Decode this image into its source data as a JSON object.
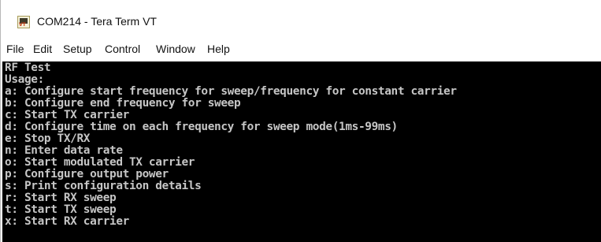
{
  "window": {
    "title": "COM214 - Tera Term VT",
    "app_icon": "tera-term-icon"
  },
  "menu": {
    "file": "File",
    "edit": "Edit",
    "setup": "Setup",
    "control": "Control",
    "window": "Window",
    "help": "Help"
  },
  "terminal": {
    "background": "#000000",
    "foreground": "#c6c6c6",
    "lines": [
      "RF Test",
      "Usage:",
      "a: Configure start frequency for sweep/frequency for constant carrier",
      "b: Configure end frequency for sweep",
      "c: Start TX carrier",
      "d: Configure time on each frequency for sweep mode(1ms-99ms)",
      "e: Stop TX/RX",
      "n: Enter data rate",
      "o: Start modulated TX carrier",
      "p: Configure output power",
      "s: Print configuration details",
      "r: Start RX sweep",
      "t: Start TX sweep",
      "x: Start RX carrier"
    ]
  }
}
